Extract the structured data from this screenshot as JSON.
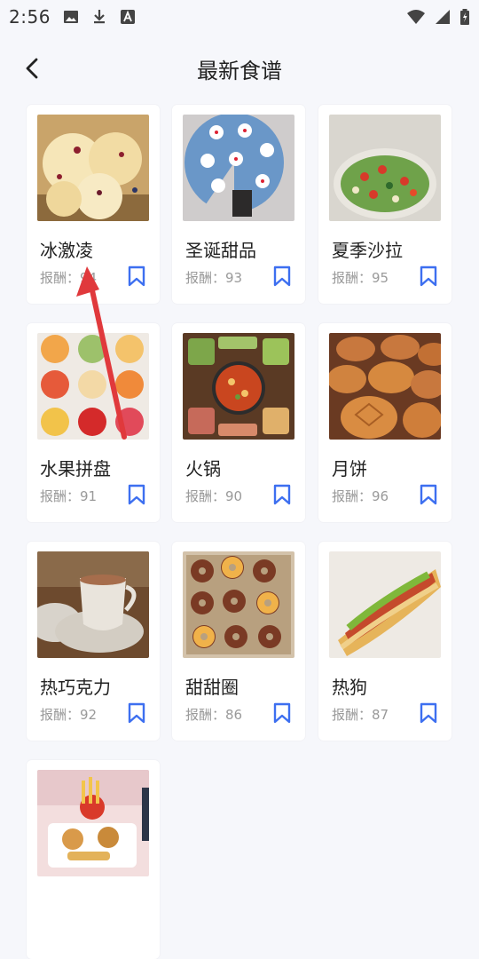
{
  "status": {
    "time": "2:56"
  },
  "header": {
    "title": "最新食谱"
  },
  "recipes": [
    {
      "name": "冰激凌",
      "reward_label": "报酬：",
      "reward": "94"
    },
    {
      "name": "圣诞甜品",
      "reward_label": "报酬：",
      "reward": "93"
    },
    {
      "name": "夏季沙拉",
      "reward_label": "报酬：",
      "reward": "95"
    },
    {
      "name": "水果拼盘",
      "reward_label": "报酬：",
      "reward": "91"
    },
    {
      "name": "火锅",
      "reward_label": "报酬：",
      "reward": "90"
    },
    {
      "name": "月饼",
      "reward_label": "报酬：",
      "reward": "96"
    },
    {
      "name": "热巧克力",
      "reward_label": "报酬：",
      "reward": "92"
    },
    {
      "name": "甜甜圈",
      "reward_label": "报酬：",
      "reward": "86"
    },
    {
      "name": "热狗",
      "reward_label": "报酬：",
      "reward": "87"
    },
    {
      "name": "",
      "reward_label": "",
      "reward": ""
    }
  ],
  "colors": {
    "accent": "#3d6ff0",
    "arrow": "#e0393c"
  }
}
